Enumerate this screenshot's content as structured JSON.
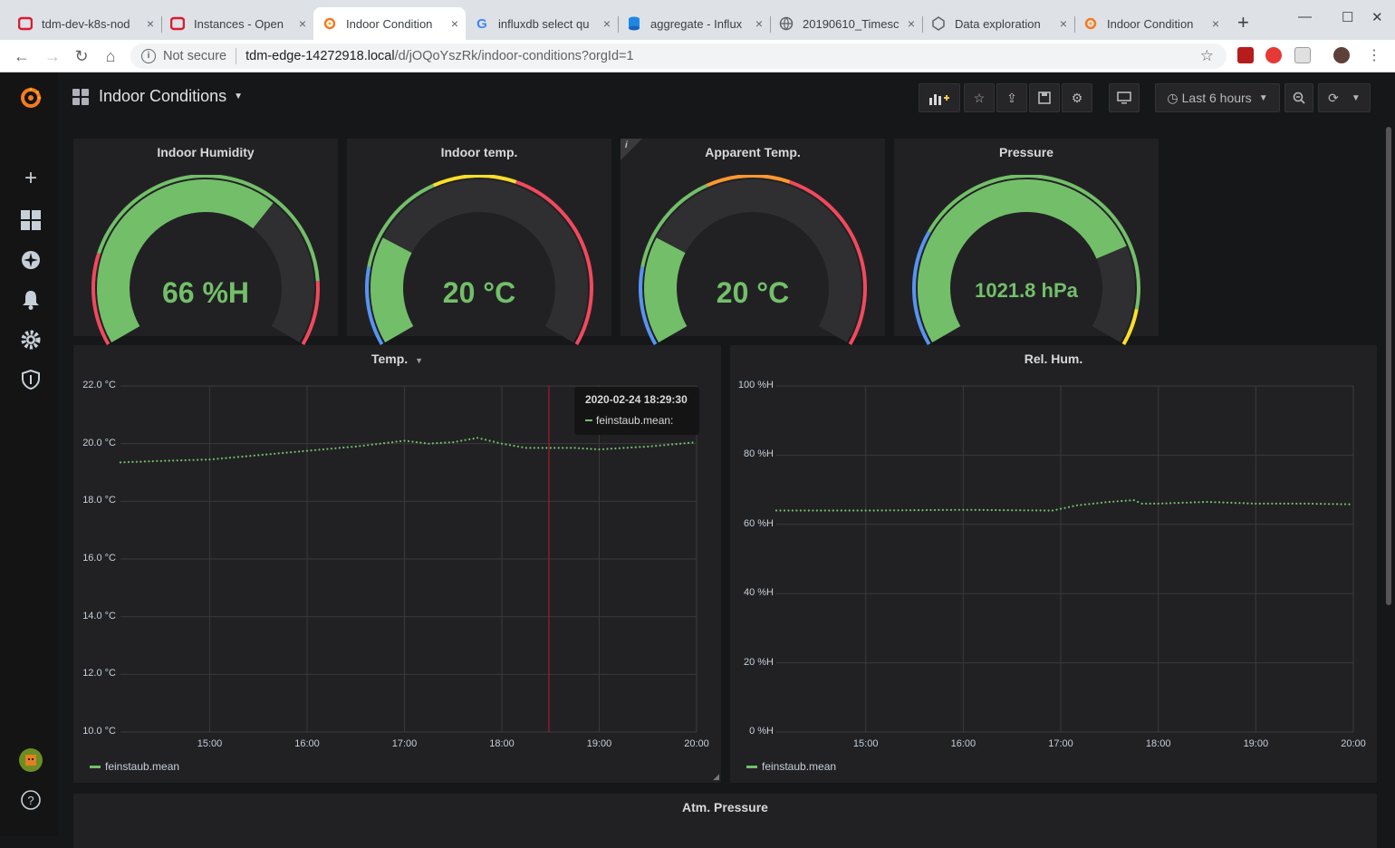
{
  "browser": {
    "tabs": [
      {
        "title": "tdm-dev-k8s-nod",
        "icon": "openstack-icon"
      },
      {
        "title": "Instances - Open",
        "icon": "openstack-icon"
      },
      {
        "title": "Indoor Condition",
        "icon": "grafana-icon",
        "active": true
      },
      {
        "title": "influxdb select qu",
        "icon": "google-icon"
      },
      {
        "title": "aggregate - Influx",
        "icon": "database-icon"
      },
      {
        "title": "20190610_Timesc",
        "icon": "globe-icon"
      },
      {
        "title": "Data exploration",
        "icon": "chronograf-icon"
      },
      {
        "title": "Indoor Condition",
        "icon": "grafana-icon"
      }
    ],
    "close_glyph": "×",
    "new_tab_glyph": "+",
    "address": {
      "security_label": "Not secure",
      "host": "tdm-edge-14272918.local",
      "path": "/d/jOQoYszRk/indoor-conditions?orgId=1"
    }
  },
  "dashboard": {
    "title": "Indoor Conditions",
    "time_range": "Last 6 hours",
    "accent": "#73bf69",
    "threshold_colors": {
      "red": "#f2495c",
      "green": "#73bf69",
      "yellow": "#fade2a",
      "blue": "#5794f2",
      "orange": "#ff9830"
    }
  },
  "gauges": [
    {
      "title": "Indoor Humidity",
      "value": "66 %H",
      "fill": 0.66,
      "thresholds": [
        {
          "from": 0,
          "to": 0.2,
          "color": "red"
        },
        {
          "from": 0.2,
          "to": 0.86,
          "color": "green"
        },
        {
          "from": 0.86,
          "to": 1,
          "color": "red"
        }
      ]
    },
    {
      "title": "Indoor temp.",
      "value": "20 °C",
      "fill": 0.24,
      "thresholds": [
        {
          "from": 0,
          "to": 0.17,
          "color": "blue"
        },
        {
          "from": 0.17,
          "to": 0.4,
          "color": "green"
        },
        {
          "from": 0.4,
          "to": 0.58,
          "color": "yellow"
        },
        {
          "from": 0.58,
          "to": 1,
          "color": "red"
        }
      ]
    },
    {
      "title": "Apparent Temp.",
      "value": "20 °C",
      "fill": 0.24,
      "info": "i",
      "thresholds": [
        {
          "from": 0,
          "to": 0.17,
          "color": "blue"
        },
        {
          "from": 0.17,
          "to": 0.4,
          "color": "green"
        },
        {
          "from": 0.4,
          "to": 0.58,
          "color": "orange"
        },
        {
          "from": 0.58,
          "to": 1,
          "color": "red"
        }
      ]
    },
    {
      "title": "Pressure",
      "value": "1021.8 hPa",
      "fill": 0.78,
      "thresholds": [
        {
          "from": 0,
          "to": 0.25,
          "color": "blue"
        },
        {
          "from": 0.25,
          "to": 0.92,
          "color": "green"
        },
        {
          "from": 0.92,
          "to": 1,
          "color": "yellow"
        }
      ]
    }
  ],
  "graphs": {
    "temp": {
      "title": "Temp.",
      "yticks": [
        "22.0 °C",
        "20.0 °C",
        "18.0 °C",
        "16.0 °C",
        "14.0 °C",
        "12.0 °C",
        "10.0 °C"
      ],
      "xticks": [
        "15:00",
        "16:00",
        "17:00",
        "18:00",
        "19:00",
        "20:00"
      ],
      "legend": "feinstaub.mean",
      "tooltip": {
        "time": "2020-02-24 18:29:30",
        "series": "feinstaub.mean:"
      }
    },
    "hum": {
      "title": "Rel. Hum.",
      "yticks": [
        "100 %H",
        "80 %H",
        "60 %H",
        "40 %H",
        "20 %H",
        "0 %H"
      ],
      "xticks": [
        "15:00",
        "16:00",
        "17:00",
        "18:00",
        "19:00",
        "20:00"
      ],
      "legend": "feinstaub.mean"
    },
    "pressure": {
      "title": "Atm. Pressure"
    }
  },
  "chart_data": [
    {
      "type": "scatter",
      "title": "Temp.",
      "series": [
        {
          "name": "feinstaub.mean",
          "x": [
            "14:05",
            "14:30",
            "15:00",
            "15:30",
            "16:00",
            "16:30",
            "17:00",
            "17:15",
            "17:30",
            "17:45",
            "18:00",
            "18:15",
            "18:30",
            "18:45",
            "19:00",
            "19:30",
            "20:00"
          ],
          "y": [
            19.35,
            19.4,
            19.45,
            19.6,
            19.75,
            19.9,
            20.1,
            20.0,
            20.05,
            20.2,
            20.0,
            19.85,
            19.85,
            19.85,
            19.8,
            19.9,
            20.05
          ]
        }
      ],
      "ylim": [
        10,
        22
      ],
      "xlim": [
        "14:05",
        "20:00"
      ]
    },
    {
      "type": "scatter",
      "title": "Rel. Hum.",
      "series": [
        {
          "name": "feinstaub.mean",
          "x": [
            "14:05",
            "15:00",
            "16:00",
            "16:55",
            "17:10",
            "17:30",
            "17:45",
            "17:50",
            "18:00",
            "18:30",
            "19:00",
            "19:30",
            "20:00"
          ],
          "y": [
            64,
            64,
            64.2,
            64,
            65.5,
            66.5,
            67,
            66,
            66,
            66.5,
            66,
            66,
            65.8
          ]
        }
      ],
      "ylim": [
        0,
        100
      ],
      "xlim": [
        "14:05",
        "20:00"
      ]
    }
  ]
}
